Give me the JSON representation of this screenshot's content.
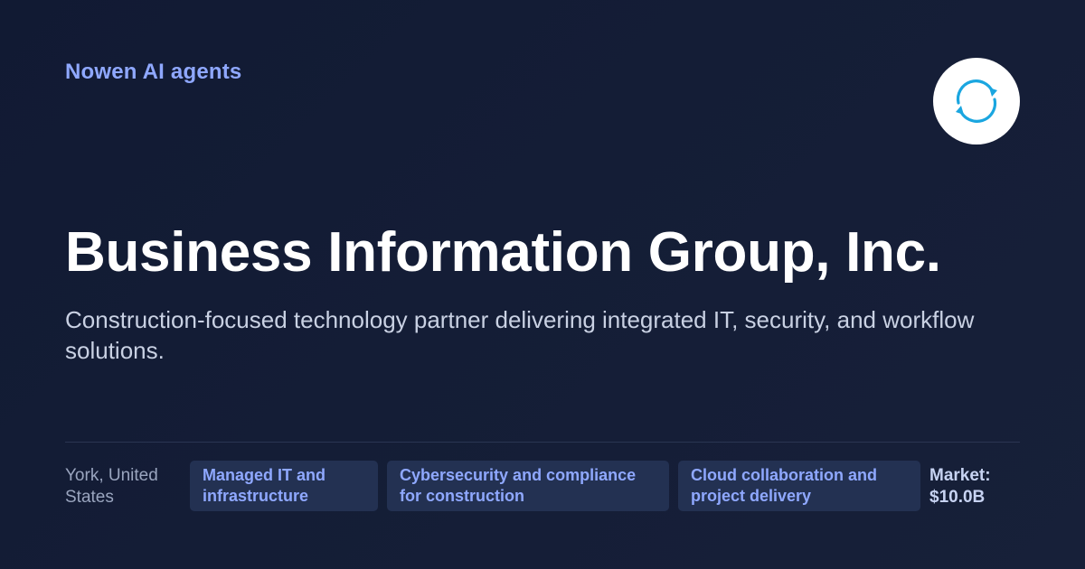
{
  "brand": {
    "name": "Nowen AI agents"
  },
  "logo": {
    "icon": "refresh-cycle-icon",
    "color": "#1aa6e0"
  },
  "company": {
    "name": "Business Information Group, Inc.",
    "description": "Construction-focused technology partner delivering integrated IT, security, and workflow solutions."
  },
  "footer": {
    "location": "York, United States",
    "tags": [
      "Managed IT and infrastructure",
      "Cybersecurity and compliance for construction",
      "Cloud collaboration and project delivery"
    ],
    "market_label": "Market:",
    "market_value": "$10.0B"
  },
  "colors": {
    "background": "#121b33",
    "accent": "#8fa8ff",
    "tag_background": "#233152"
  }
}
